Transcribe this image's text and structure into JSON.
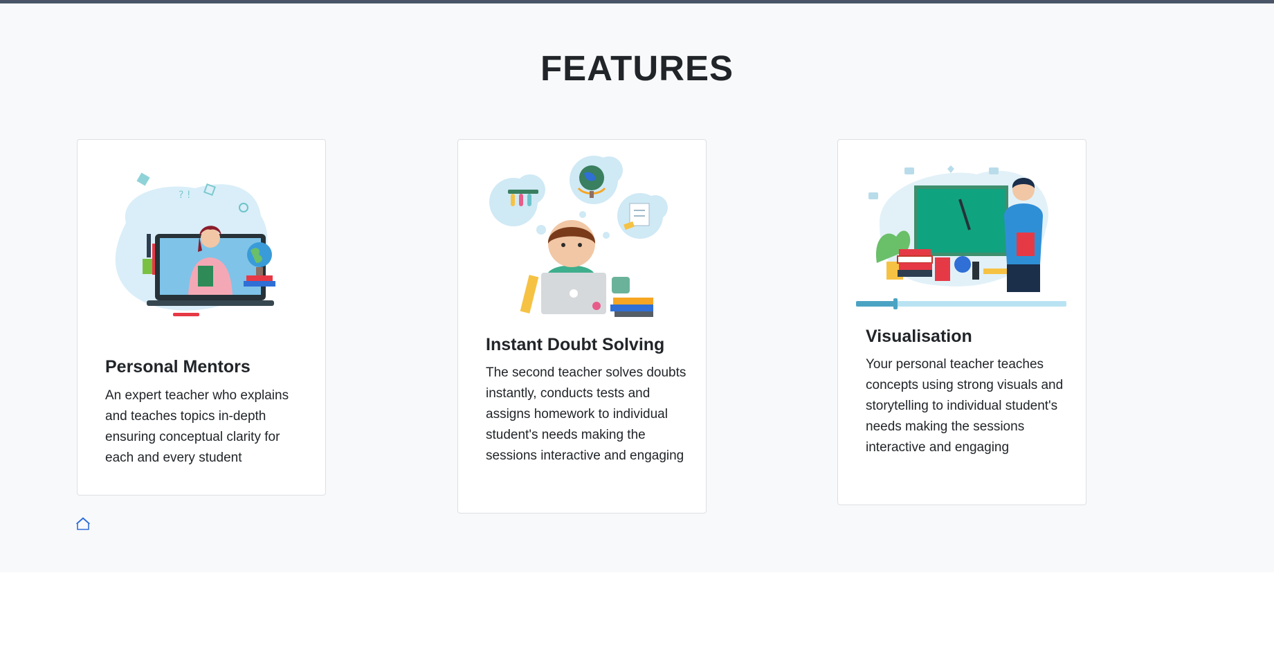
{
  "page": {
    "title": "FEATURES"
  },
  "features": [
    {
      "title": "Personal Mentors",
      "description": "An expert teacher who explains and teaches topics in-depth ensuring conceptual clarity for each and every student",
      "illustration": "teacher-on-laptop-illustration"
    },
    {
      "title": "Instant Doubt Solving",
      "description": "The second teacher solves doubts instantly, conducts tests and assigns homework to individual student's needs making the sessions interactive and engaging",
      "illustration": "student-thinking-illustration"
    },
    {
      "title": "Visualisation",
      "description": "Your personal teacher teaches concepts using strong visuals and storytelling to individual student's needs making the sessions interactive and engaging",
      "illustration": "teacher-at-board-illustration"
    }
  ],
  "footer": {
    "home_icon": "home-icon"
  },
  "colors": {
    "accent": "#2f6fd6",
    "section_bg": "#f8f9fa",
    "top_bar": "#4a5568"
  }
}
